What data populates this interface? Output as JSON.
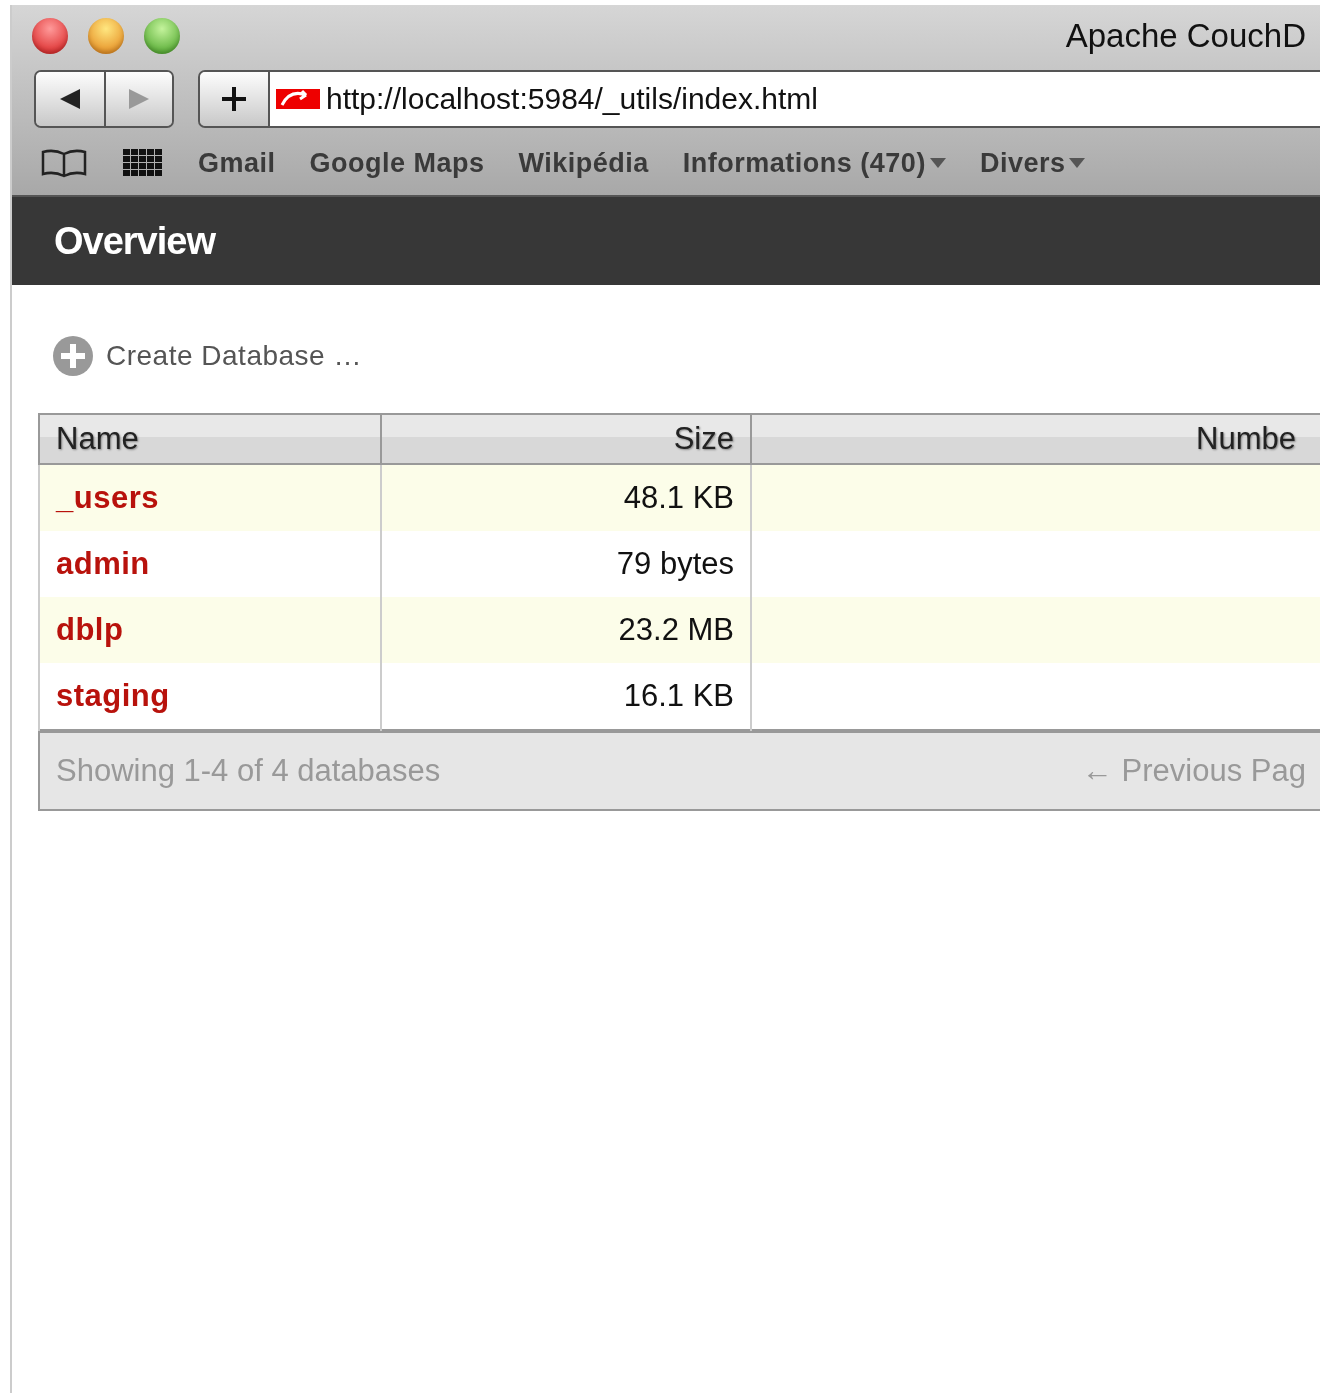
{
  "window": {
    "title": "Apache CouchD"
  },
  "toolbar": {
    "url": "http://localhost:5984/_utils/index.html"
  },
  "bookmarks": [
    {
      "label": "Gmail",
      "kind": "link"
    },
    {
      "label": "Google Maps",
      "kind": "link"
    },
    {
      "label": "Wikipédia",
      "kind": "link"
    },
    {
      "label": "Informations (470)",
      "kind": "menu"
    },
    {
      "label": "Divers",
      "kind": "menu"
    }
  ],
  "header": {
    "title": "Overview"
  },
  "create_database": "Create Database …",
  "table": {
    "columns": [
      {
        "label": "Name"
      },
      {
        "label": "Size"
      },
      {
        "label": "Numbe"
      }
    ],
    "rows": [
      {
        "name": "_users",
        "size": "48.1 KB"
      },
      {
        "name": "admin",
        "size": "79 bytes"
      },
      {
        "name": "dblp",
        "size": "23.2 MB"
      },
      {
        "name": "staging",
        "size": "16.1 KB"
      }
    ]
  },
  "footer": {
    "summary": "Showing 1-4 of 4 databases",
    "previous": "← Previous Pag"
  }
}
